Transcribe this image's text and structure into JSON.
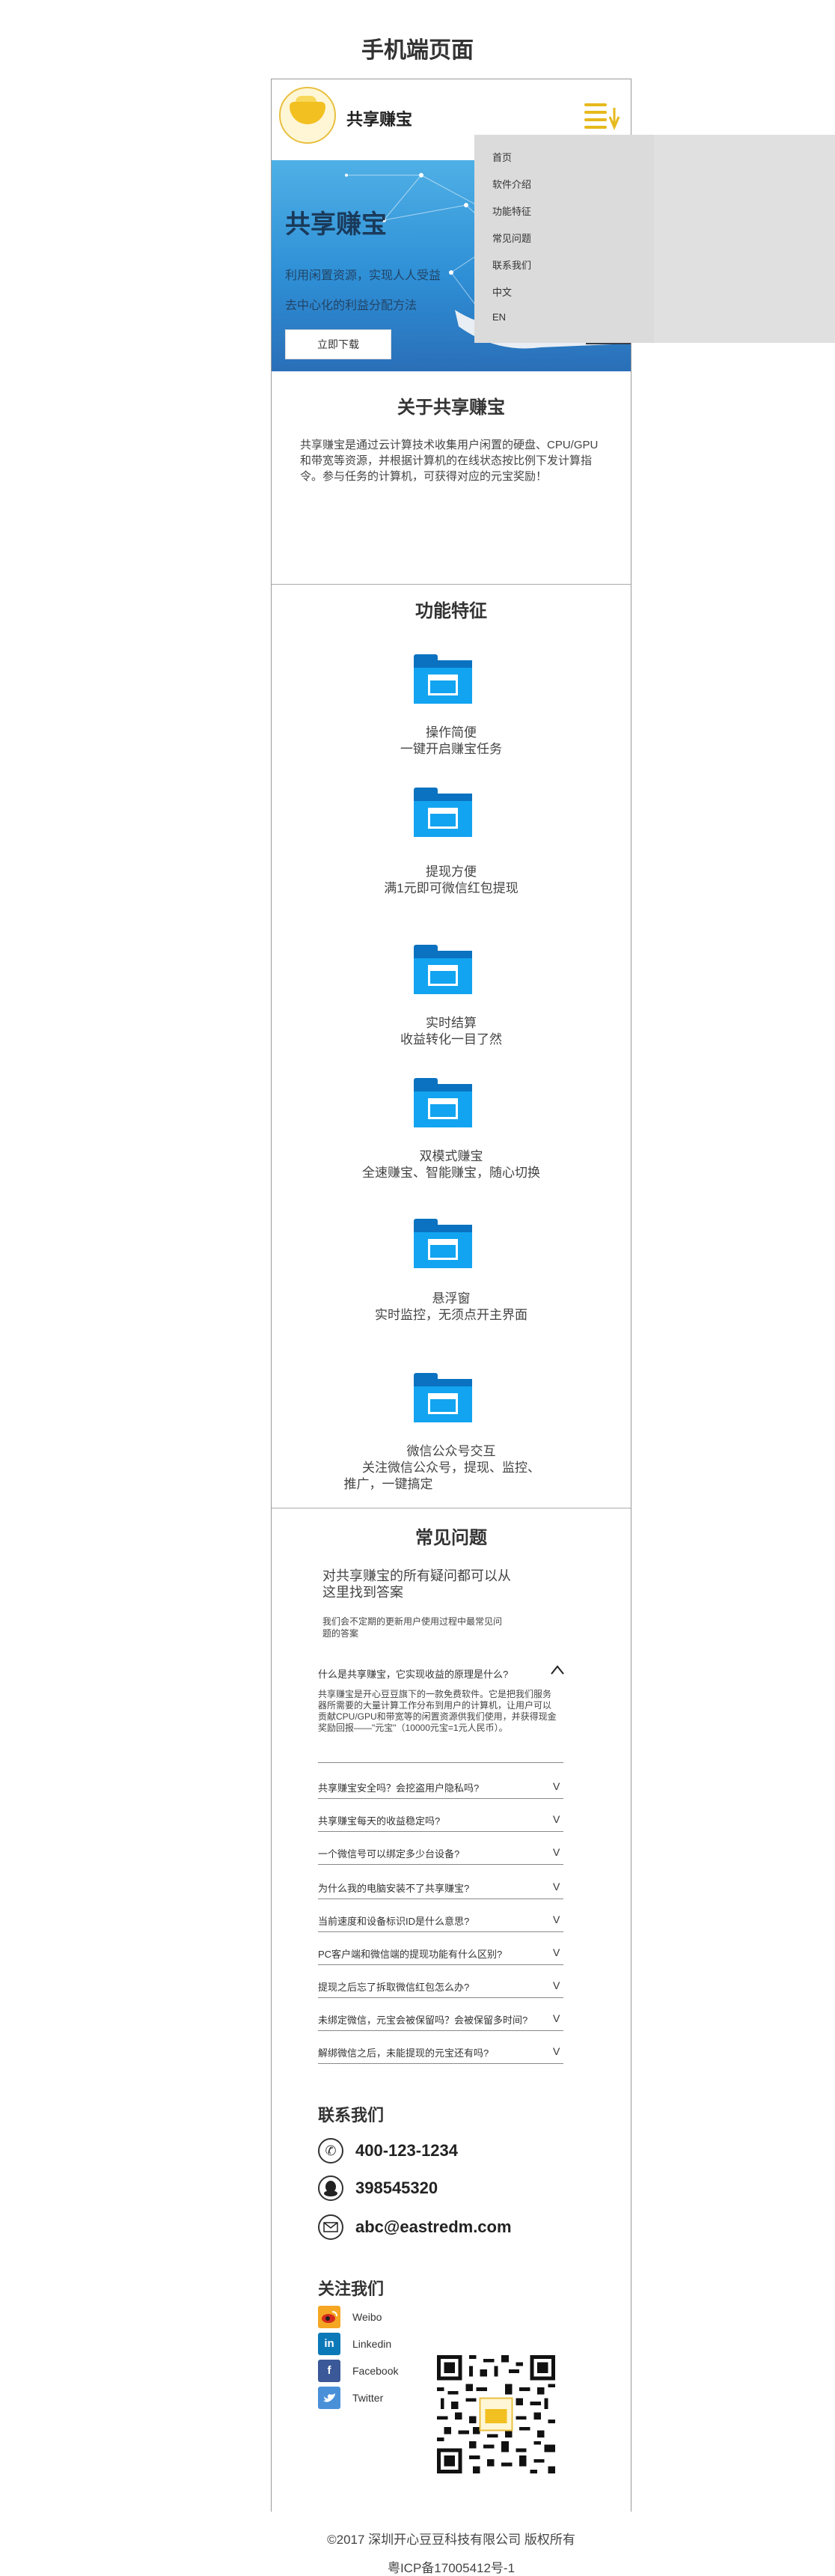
{
  "page": {
    "title": "手机端页面"
  },
  "header": {
    "brand": "共享赚宝",
    "menu_icon": "menu-icon"
  },
  "hero": {
    "title": "共享赚宝",
    "subtitle_line1": "利用闲置资源，实现人人受益",
    "subtitle_line2": "去中心化的利益分配方法",
    "button": "立即下载"
  },
  "nav": {
    "items": [
      "首页",
      "软件介绍",
      "功能特征",
      "常见问题",
      "联系我们",
      "中文",
      "EN"
    ]
  },
  "about": {
    "title": "关于共享赚宝",
    "text": "共享赚宝是通过云计算技术收集用户闲置的硬盘、CPU/GPU和带宽等资源，并根据计算机的在线状态按比例下发计算指令。参与任务的计算机，可获得对应的元宝奖励！"
  },
  "features": {
    "title": "功能特征",
    "items": [
      {
        "name": "操作简便",
        "desc": "一键开启赚宝任务"
      },
      {
        "name": "提现方便",
        "desc": "满1元即可微信红包提现"
      },
      {
        "name": "实时结算",
        "desc": "收益转化一目了然"
      },
      {
        "name": "双模式赚宝",
        "desc": "全速赚宝、智能赚宝，随心切换"
      },
      {
        "name": "悬浮窗",
        "desc": "实时监控，无须点开主界面"
      },
      {
        "name": "微信公众号交互",
        "desc": "关注微信公众号，提现、监控、",
        "desc2": "推广，一键搞定"
      }
    ]
  },
  "faq": {
    "title": "常见问题",
    "intro": "对共享赚宝的所有疑问都可以从这里找到答案",
    "intro_small": "我们会不定期的更新用户使用过程中最常见问题的答案",
    "open_question": "什么是共享赚宝，它实现收益的原理是什么?",
    "open_arrow": "^",
    "open_answer": "共享赚宝是开心豆豆旗下的一款免费软件。它是把我们服务器所需要的大量计算工作分布到用户的计算机，让用户可以贡献CPU/GPU和带宽等的闲置资源供我们使用，并获得现金奖励回报——\"元宝\"（10000元宝=1元人民币）。",
    "questions": [
      "共享赚宝安全吗？会挖盗用户隐私吗?",
      "共享赚宝每天的收益稳定吗?",
      "一个微信号可以绑定多少台设备?",
      "为什么我的电脑安装不了共享赚宝?",
      "当前速度和设备标识ID是什么意思?",
      "PC客户端和微信端的提现功能有什么区别?",
      "提现之后忘了拆取微信红包怎么办?",
      "未绑定微信，元宝会被保留吗？会被保留多时间?",
      "解绑微信之后，未能提现的元宝还有吗?"
    ],
    "closed_arrow": "V"
  },
  "contact": {
    "title": "联系我们",
    "phone": "400-123-1234",
    "qq": "398545320",
    "email": "abc@eastredm.com"
  },
  "follow": {
    "title": "关注我们",
    "items": [
      "Weibo",
      "Linkedin",
      "Facebook",
      "Twitter"
    ]
  },
  "footer": {
    "copyright": "©2017 深圳开心豆豆科技有限公司 版权所有",
    "icp": "粤ICP备17005412号-1"
  },
  "colors": {
    "accent_yellow": "#e6b91d",
    "folder_blue": "#12a4f0",
    "hero_blue": "#2e8fd6"
  }
}
